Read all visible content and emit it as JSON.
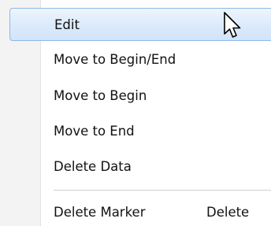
{
  "context_menu": {
    "items": [
      {
        "label": "Edit",
        "highlighted": true
      },
      {
        "label": "Move to Begin/End"
      },
      {
        "label": "Move to Begin"
      },
      {
        "label": "Move to End"
      },
      {
        "label": "Delete Data"
      },
      {
        "label": "Delete Marker",
        "shortcut": "Delete"
      }
    ]
  },
  "colors": {
    "highlight_fill": "#dbeafb",
    "highlight_border": "#8fb8e6",
    "gutter": "#f3f3f3",
    "text": "#111111"
  },
  "icons": {
    "cursor": "mouse-pointer-icon"
  }
}
